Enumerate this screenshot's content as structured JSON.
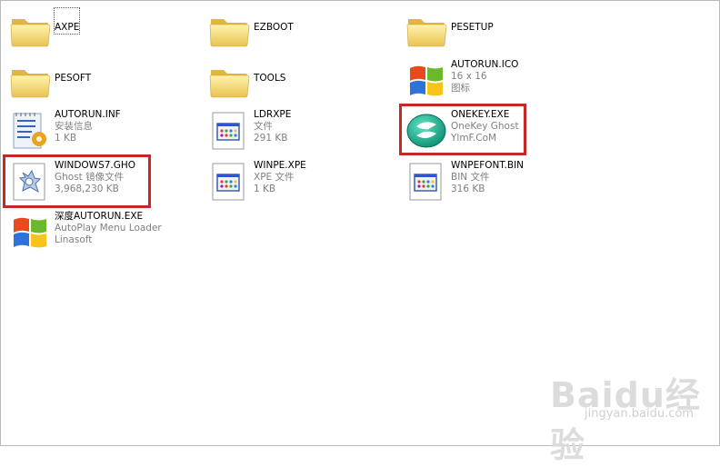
{
  "files": [
    {
      "name": "AXPE",
      "type": "folder",
      "col": 0,
      "row": 0
    },
    {
      "name": "EZBOOT",
      "type": "folder",
      "col": 1,
      "row": 0
    },
    {
      "name": "PESETUP",
      "type": "folder",
      "col": 2,
      "row": 0
    },
    {
      "name": "PESOFT",
      "type": "folder",
      "col": 0,
      "row": 1
    },
    {
      "name": "TOOLS",
      "type": "folder",
      "col": 1,
      "row": 1
    },
    {
      "name": "AUTORUN.ICO",
      "line2": "16 x 16",
      "line3": "图标",
      "type": "winlogo",
      "col": 2,
      "row": 1
    },
    {
      "name": "AUTORUN.INF",
      "line2": "安装信息",
      "line3": "1 KB",
      "type": "inf",
      "col": 0,
      "row": 2
    },
    {
      "name": "LDRXPE",
      "line2": "文件",
      "line3": "291 KB",
      "type": "generic",
      "col": 1,
      "row": 2
    },
    {
      "name": "ONEKEY.EXE",
      "line2": "OneKey Ghost",
      "line3": "YlmF.CoM",
      "type": "onekey",
      "col": 2,
      "row": 2
    },
    {
      "name": "WINDOWS7.GHO",
      "line2": "Ghost 镜像文件",
      "line3": "3,968,230 KB",
      "type": "ghost",
      "col": 0,
      "row": 3
    },
    {
      "name": "WINPE.XPE",
      "line2": "XPE 文件",
      "line3": "1 KB",
      "type": "generic",
      "col": 1,
      "row": 3
    },
    {
      "name": "WNPEFONT.BIN",
      "line2": "BIN 文件",
      "line3": "316 KB",
      "type": "generic",
      "col": 2,
      "row": 3
    },
    {
      "name": "深度AUTORUN.EXE",
      "line2": "AutoPlay Menu Loader",
      "line3": "Linasoft",
      "type": "winlogo",
      "col": 0,
      "row": 4
    }
  ],
  "highlighted": [
    "WINDOWS7.GHO",
    "ONEKEY.EXE"
  ],
  "selected_outline": "AXPE",
  "watermark": {
    "main": "Baidu经验",
    "sub": "jingyan.baidu.com"
  },
  "colors": {
    "highlight": "#c62828",
    "subtext": "#808080"
  }
}
